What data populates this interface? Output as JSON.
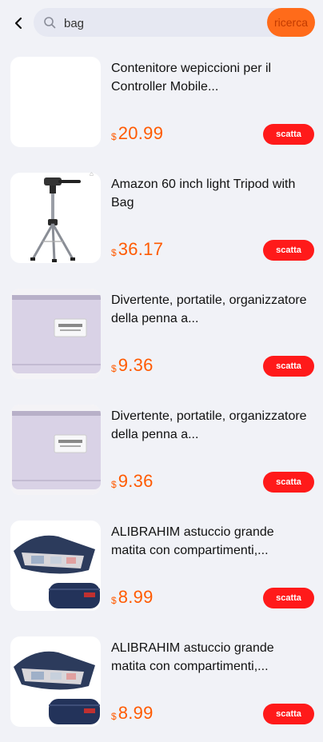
{
  "header": {
    "search_value": "bag",
    "search_button": "ricerca"
  },
  "products": [
    {
      "title": "Contenitore wepiccioni per il Controller Mobile...",
      "currency": "$",
      "price": "20.99",
      "action": "scatta",
      "image": "blank"
    },
    {
      "title": "Amazon 60 inch light Tripod with Bag",
      "currency": "$",
      "price": "36.17",
      "action": "scatta",
      "image": "tripod"
    },
    {
      "title": "Divertente, portatile, organizzatore della penna a...",
      "currency": "$",
      "price": "9.36",
      "action": "scatta",
      "image": "pouch"
    },
    {
      "title": "Divertente, portatile, organizzatore della penna a...",
      "currency": "$",
      "price": "9.36",
      "action": "scatta",
      "image": "pouch"
    },
    {
      "title": "ALIBRAHIM astuccio grande matita con compartimenti,...",
      "currency": "$",
      "price": "8.99",
      "action": "scatta",
      "image": "pencilcase"
    },
    {
      "title": "ALIBRAHIM astuccio grande matita con compartimenti,...",
      "currency": "$",
      "price": "8.99",
      "action": "scatta",
      "image": "pencilcase"
    }
  ]
}
